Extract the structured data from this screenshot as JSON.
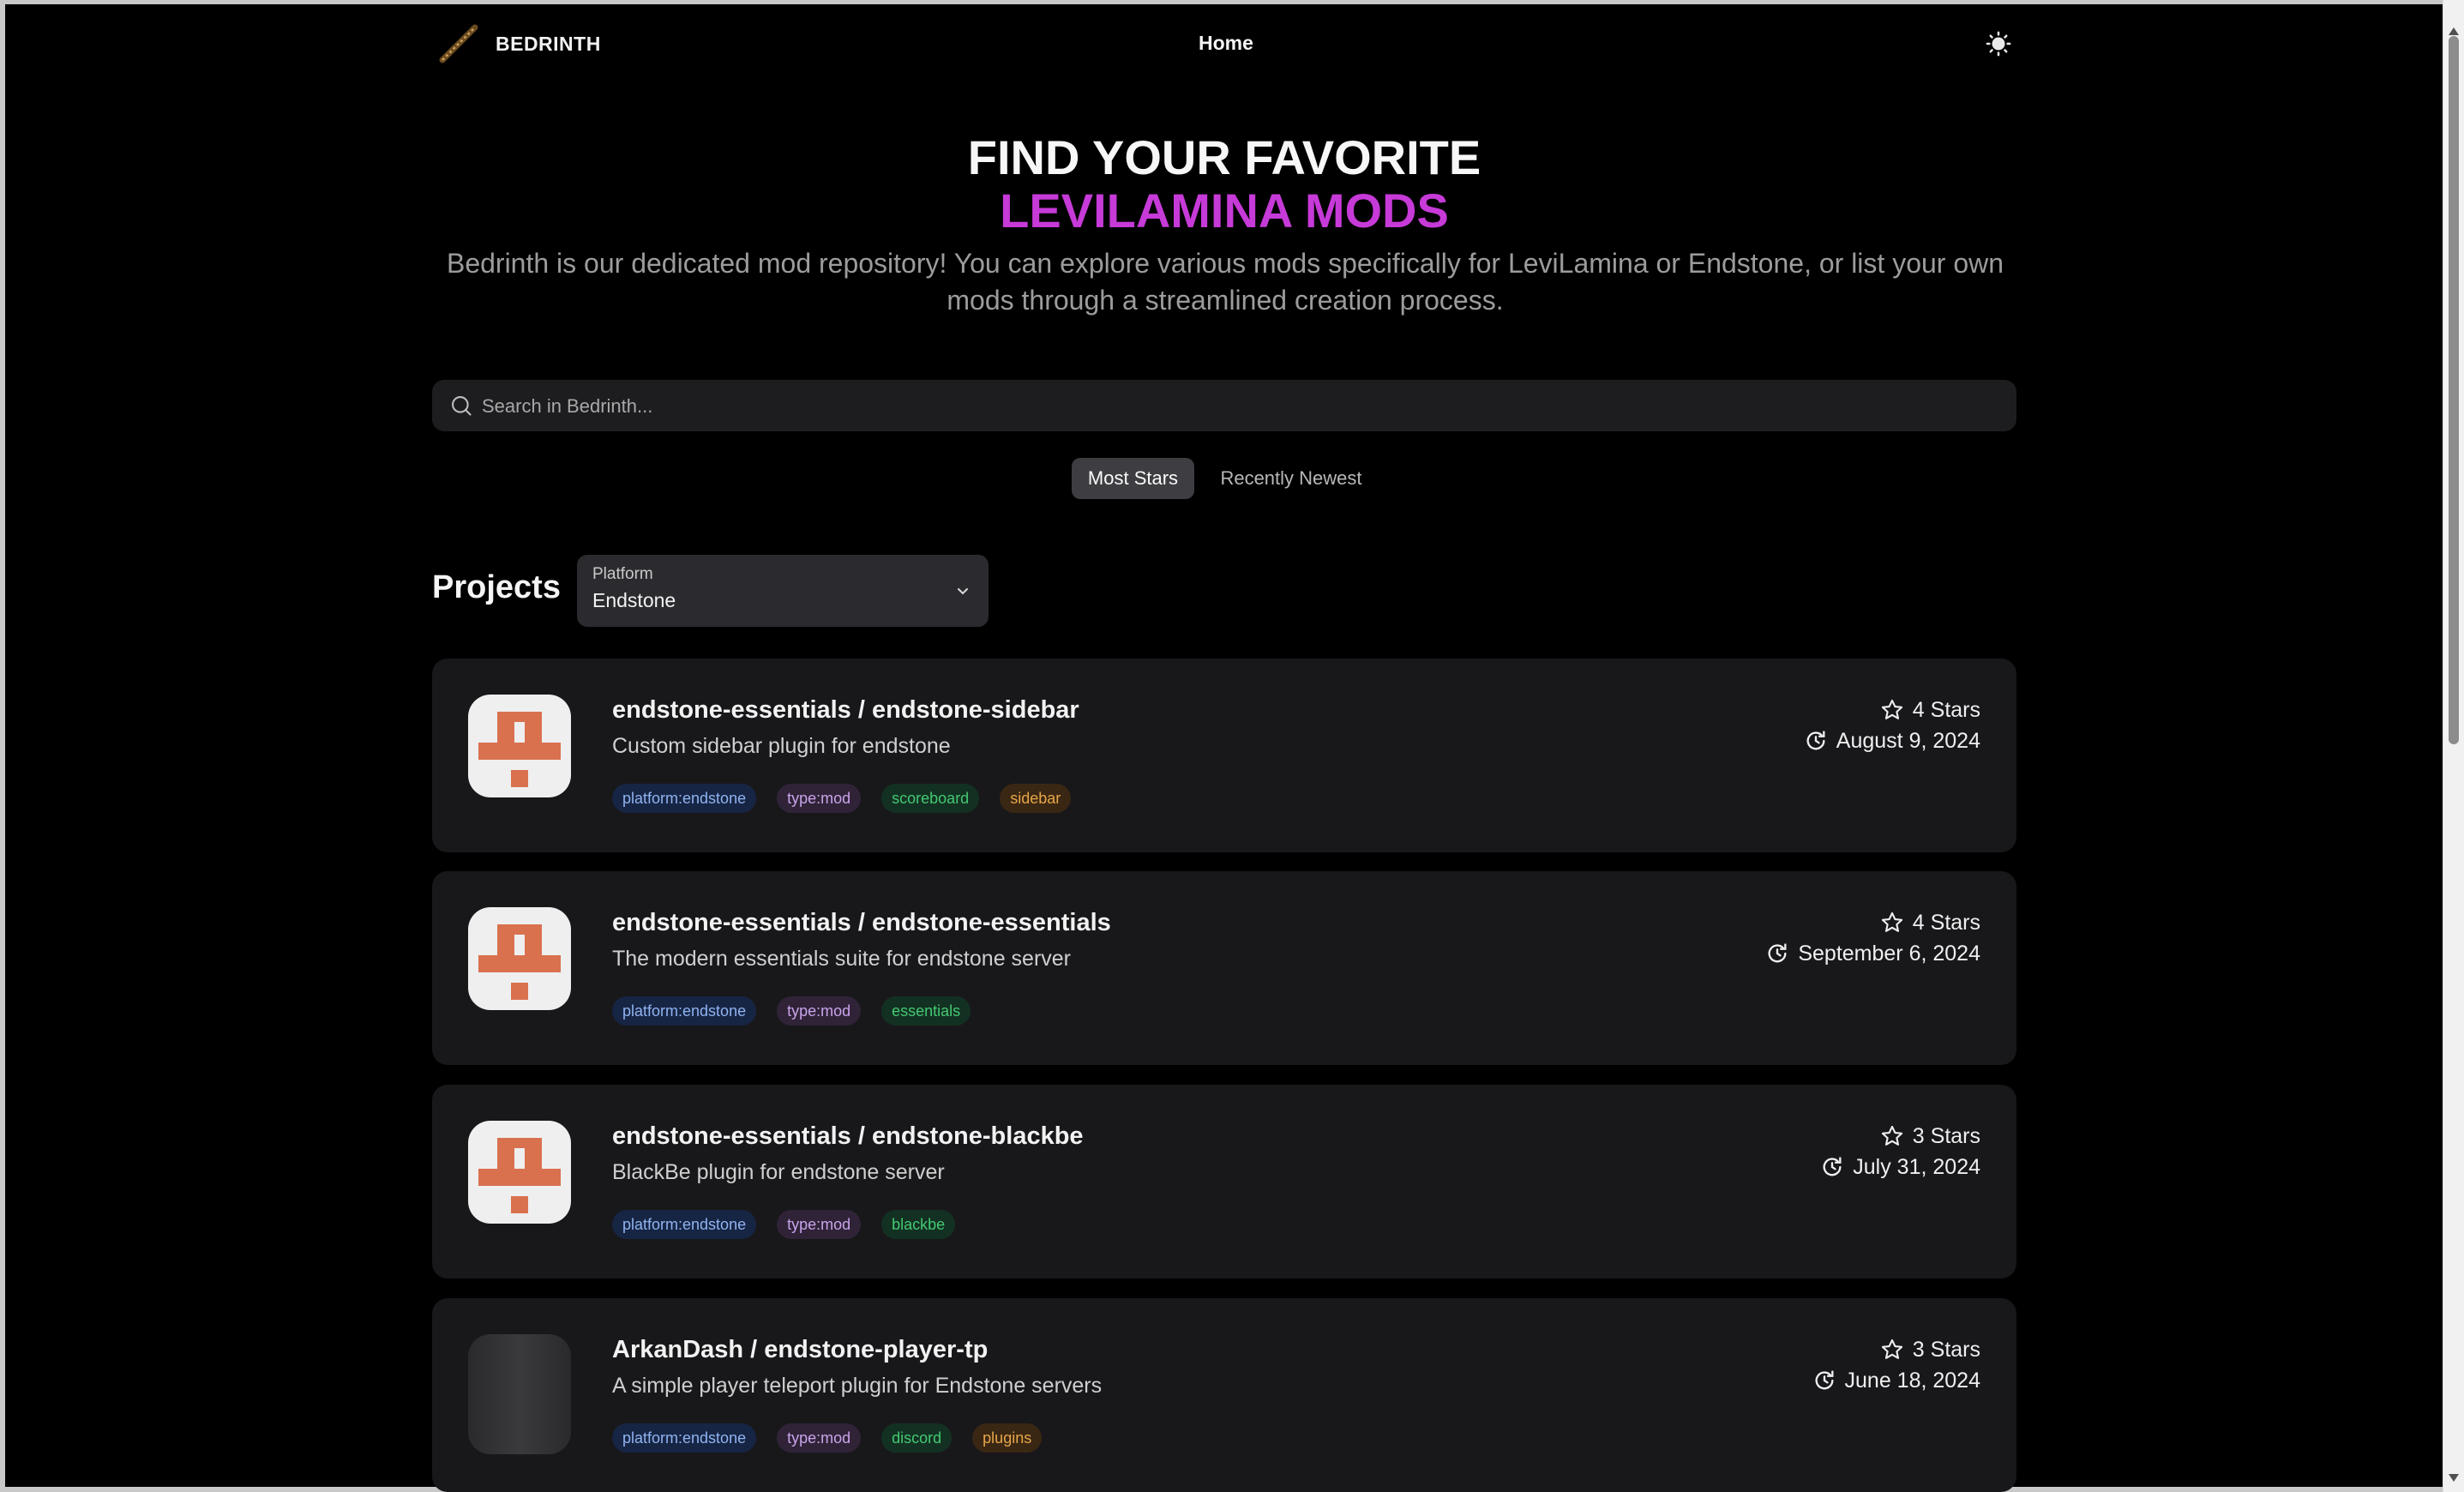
{
  "header": {
    "brand": "BEDRINTH",
    "nav_home": "Home"
  },
  "hero": {
    "title_line1": "FIND YOUR FAVORITE",
    "title_line2": "LEVILAMINA MODS",
    "description": "Bedrinth is our dedicated mod repository! You can explore various mods specifically for LeviLamina or Endstone, or list your own mods through a streamlined creation process."
  },
  "search": {
    "placeholder": "Search in Bedrinth...",
    "value": ""
  },
  "sort_tabs": {
    "active": "Most Stars",
    "inactive": "Recently Newest"
  },
  "projects": {
    "title": "Projects",
    "platform_label": "Platform",
    "platform_value": "Endstone",
    "items": [
      {
        "title": "endstone-essentials / endstone-sidebar",
        "description": "Custom sidebar plugin for endstone",
        "stars": "4 Stars",
        "date": "August 9, 2024",
        "tags": [
          "platform:endstone",
          "type:mod",
          "scoreboard",
          "sidebar"
        ]
      },
      {
        "title": "endstone-essentials / endstone-essentials",
        "description": "The modern essentials suite for endstone server",
        "stars": "4 Stars",
        "date": "September 6, 2024",
        "tags": [
          "platform:endstone",
          "type:mod",
          "essentials"
        ]
      },
      {
        "title": "endstone-essentials / endstone-blackbe",
        "description": "BlackBe plugin for endstone server",
        "stars": "3 Stars",
        "date": "July 31, 2024",
        "tags": [
          "platform:endstone",
          "type:mod",
          "blackbe"
        ]
      },
      {
        "title": "ArkanDash / endstone-player-tp",
        "description": "A simple player teleport plugin for Endstone servers",
        "stars": "3 Stars",
        "date": "June 18, 2024",
        "tags": [
          "platform:endstone",
          "type:mod",
          "discord",
          "plugins"
        ]
      }
    ]
  },
  "colors": {
    "accent_magenta": "#c63ad8",
    "avatar_orange": "#d9714f",
    "tag_blue": "#8fb3f0",
    "tag_purple": "#c9a4ea",
    "tag_green": "#44c873",
    "tag_orange": "#e6a64a"
  },
  "icons": {
    "theme": "sun-icon",
    "search": "search-icon",
    "star": "star-icon",
    "updated": "history-icon",
    "dropdown": "chevron-down-icon"
  }
}
